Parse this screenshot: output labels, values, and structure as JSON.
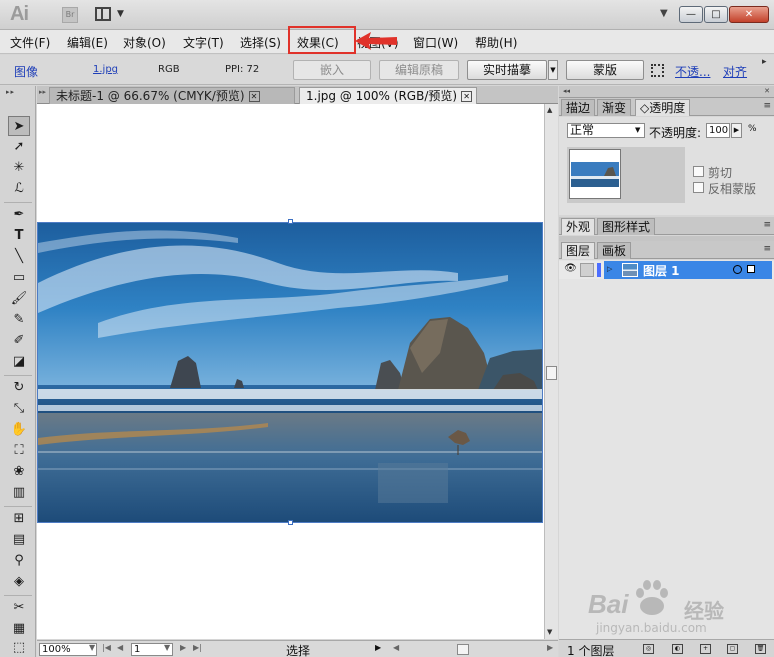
{
  "titlebar": {
    "app_logo": "Ai",
    "bridge_label": "Br",
    "window_min": "—",
    "window_max": "□",
    "window_close": "✕"
  },
  "menu": {
    "items": [
      "文件(F)",
      "编辑(E)",
      "对象(O)",
      "文字(T)",
      "选择(S)",
      "效果(C)",
      "视图(V)",
      "窗口(W)",
      "帮助(H)"
    ],
    "highlighted": "效果(C)",
    "highlight_color": "#e0322a"
  },
  "control": {
    "type_label": "图像",
    "filename": "1.jpg",
    "color_mode": "RGB",
    "ppi": "PPI: 72",
    "embed_button": "嵌入",
    "edit_original_button": "编辑原稿",
    "live_trace_button": "实时描摹",
    "mask_button": "蒙版",
    "opacity_link": "不透...",
    "align_link": "对齐"
  },
  "tools": {
    "icons": [
      "selection-icon",
      "direct-selection-icon",
      "magic-wand-icon",
      "lasso-icon",
      "pen-icon",
      "type-icon",
      "line-icon",
      "rectangle-icon",
      "paintbrush-icon",
      "pencil-icon",
      "blob-brush-icon",
      "eraser-icon",
      "rotate-icon",
      "scale-icon",
      "warp-icon",
      "free-transform-icon",
      "symbol-sprayer-icon",
      "column-graph-icon",
      "mesh-icon",
      "gradient-icon",
      "eyedropper-icon",
      "blend-icon",
      "slice-icon",
      "bar-graph-icon",
      "artboard-icon"
    ]
  },
  "document": {
    "tabs": [
      {
        "label": "未标题-1 @ 66.67% (CMYK/预览)",
        "close": "✕"
      },
      {
        "label": "1.jpg @ 100% (RGB/预览)",
        "close": "✕"
      }
    ],
    "active_tab": 1
  },
  "status": {
    "zoom": "100%",
    "page": "1",
    "tool_name": "选择"
  },
  "transparency_panel": {
    "tabs": [
      "描边",
      "渐变",
      "透明度"
    ],
    "active_tab": "透明度",
    "blend_mode": "正常",
    "opacity_label": "不透明度:",
    "opacity_value": "100",
    "percent_sign": "%",
    "clip_label": "剪切",
    "invert_mask_label": "反相蒙版"
  },
  "appearance_panel": {
    "tabs": [
      "外观",
      "图形样式"
    ]
  },
  "layers_panel": {
    "tabs": [
      "图层",
      "画板"
    ],
    "layers": [
      {
        "name": "图层 1",
        "color": "#4d6eff",
        "selected": true
      }
    ],
    "footer_count": "1 个图层"
  },
  "watermark": {
    "brand": "Bai",
    "brand_cn": "经验",
    "url": "jingyan.baidu.com"
  },
  "colors": {
    "selection_blue": "#3a86e6",
    "link_blue": "#1f3fb8",
    "annotation_red": "#e0322a"
  }
}
